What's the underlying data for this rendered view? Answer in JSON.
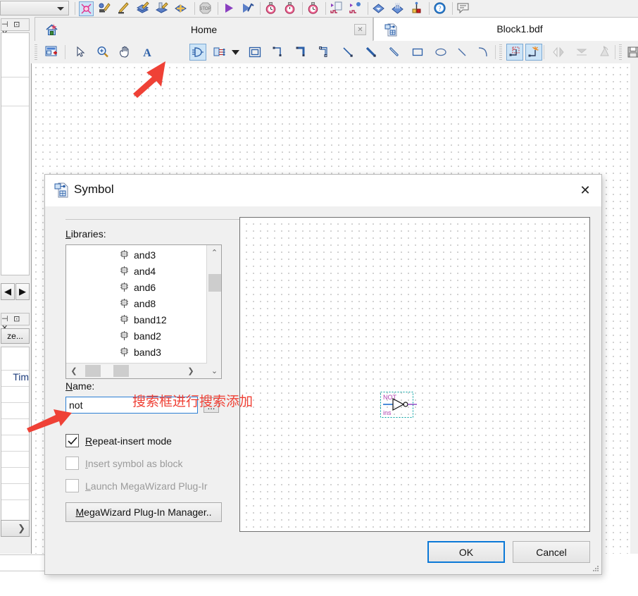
{
  "app": {
    "toolbar_combo_value": "",
    "toolbar_icons": [
      {
        "name": "compile-design-icon",
        "selected": true
      },
      {
        "name": "analysis-synthesis-icon",
        "selected": false
      },
      {
        "name": "fitter-place-route-icon",
        "selected": false
      },
      {
        "name": "assembler-icon",
        "selected": false
      },
      {
        "name": "timing-analyzer-icon",
        "selected": false
      },
      {
        "name": "eda-netlist-writer-icon",
        "selected": false
      },
      {
        "name": "stop-processing-icon",
        "selected": false
      },
      {
        "name": "start-compilation-icon",
        "selected": false
      },
      {
        "name": "start-analysis-icon",
        "selected": false
      },
      {
        "name": "timing-analyzer-tool-icon",
        "selected": false
      },
      {
        "name": "timequest-icon",
        "selected": false
      },
      {
        "name": "timing-report-icon",
        "selected": false
      },
      {
        "name": "program-device-icon",
        "selected": false
      },
      {
        "name": "signaltap-icon",
        "selected": false
      },
      {
        "name": "in-system-memory-editor-icon",
        "selected": false
      },
      {
        "name": "pin-planner-icon",
        "selected": false
      },
      {
        "name": "help-icon",
        "selected": false
      },
      {
        "name": "messages-icon",
        "selected": false
      }
    ]
  },
  "left_dock": {
    "panel1": {
      "title_glyphs": "⊣ ⊡ ✕"
    },
    "panel2": {
      "title_glyphs": "⊣ ⊡ ✕",
      "button_label": "ze..."
    },
    "nav_prev": "◀",
    "nav_next": "▶",
    "table_header": "Tim",
    "bottom_next": "❯",
    "canvas_back": "❮"
  },
  "tabs": [
    {
      "label": "Home",
      "icon": "home-icon",
      "active": false,
      "has_close": true,
      "close_label": "✕"
    },
    {
      "label": "Block1.bdf",
      "icon": "bdf-file-icon",
      "active": true,
      "has_close": false,
      "close_label": ""
    }
  ],
  "draw_toolbar": {
    "tools": [
      {
        "name": "new-block-tool-icon",
        "selected": false,
        "disabled": false
      },
      {
        "name": "selection-tool-icon",
        "selected": false,
        "disabled": false
      },
      {
        "name": "zoom-tool-icon",
        "selected": false,
        "disabled": false
      },
      {
        "name": "hand-tool-icon",
        "selected": false,
        "disabled": false
      },
      {
        "name": "text-tool-icon",
        "selected": false,
        "disabled": false
      },
      {
        "name": "symbol-tool-icon",
        "selected": true,
        "disabled": false
      },
      {
        "name": "pin-tool-icon",
        "selected": false,
        "disabled": false
      },
      {
        "name": "pin-dropdown-caret-icon",
        "selected": false,
        "disabled": false
      },
      {
        "name": "block-tool-icon",
        "selected": false,
        "disabled": false
      },
      {
        "name": "orthogonal-node-tool-icon",
        "selected": false,
        "disabled": false
      },
      {
        "name": "orthogonal-bus-tool-icon",
        "selected": false,
        "disabled": false
      },
      {
        "name": "orthogonal-conduit-tool-icon",
        "selected": false,
        "disabled": false
      },
      {
        "name": "diagonal-node-tool-icon",
        "selected": false,
        "disabled": false
      },
      {
        "name": "diagonal-bus-tool-icon",
        "selected": false,
        "disabled": false
      },
      {
        "name": "diagonal-conduit-tool-icon",
        "selected": false,
        "disabled": false
      },
      {
        "name": "rectangle-tool-icon",
        "selected": false,
        "disabled": false
      },
      {
        "name": "oval-tool-icon",
        "selected": false,
        "disabled": false
      },
      {
        "name": "line-tool-icon",
        "selected": false,
        "disabled": false
      },
      {
        "name": "arc-tool-icon",
        "selected": false,
        "disabled": false
      },
      {
        "name": "rubberbanding-icon",
        "selected": true,
        "disabled": false
      },
      {
        "name": "partial-line-select-icon",
        "selected": true,
        "disabled": false
      },
      {
        "name": "flip-horizontal-icon",
        "selected": false,
        "disabled": true
      },
      {
        "name": "flip-vertical-icon",
        "selected": false,
        "disabled": true
      },
      {
        "name": "rotate-left-icon",
        "selected": false,
        "disabled": true
      },
      {
        "name": "save-icon",
        "selected": false,
        "disabled": false
      },
      {
        "name": "print-icon",
        "selected": false,
        "disabled": false
      }
    ]
  },
  "dialog": {
    "title": "Symbol",
    "title_icon": "symbol-dialog-icon",
    "close_label": "✕",
    "libraries_label": "Libraries:",
    "libraries_accesskey": "L",
    "library_items": [
      {
        "label": "and3",
        "icon": "symbol-item-icon"
      },
      {
        "label": "and4",
        "icon": "symbol-item-icon"
      },
      {
        "label": "and6",
        "icon": "symbol-item-icon"
      },
      {
        "label": "and8",
        "icon": "symbol-item-icon"
      },
      {
        "label": "band12",
        "icon": "symbol-item-icon"
      },
      {
        "label": "band2",
        "icon": "symbol-item-icon"
      },
      {
        "label": "band3",
        "icon": "symbol-item-icon"
      }
    ],
    "scroll_up": "⌃",
    "scroll_down": "⌄",
    "scroll_left": "❮",
    "scroll_right": "❯",
    "name_label": "Name:",
    "name_accesskey": "N",
    "name_value": "not",
    "name_placeholder": "",
    "browse_label": "...",
    "checkboxes": [
      {
        "label": "Repeat-insert mode",
        "accesskey": "R",
        "checked": true,
        "disabled": false,
        "check_glyph": "✓"
      },
      {
        "label": "Insert symbol as block",
        "accesskey": "I",
        "checked": false,
        "disabled": true,
        "check_glyph": ""
      },
      {
        "label": "Launch MegaWizard Plug-Ir",
        "accesskey": "L",
        "checked": false,
        "disabled": true,
        "check_glyph": ""
      }
    ],
    "megawizard_button": "MegaWizard Plug-In Manager..",
    "megawizard_accesskey": "M",
    "ok_label": "OK",
    "cancel_label": "Cancel",
    "preview_symbol": {
      "title": "NOT",
      "instance": "ins",
      "outline_color": "#00a0a0",
      "title_color": "#b040b0",
      "port_color": "#1f6fd0"
    }
  },
  "annotations": {
    "text": "搜索框进行搜索添加",
    "color": "#ef4136",
    "arrows": [
      {
        "name": "arrow-to-symbol-tool"
      },
      {
        "name": "arrow-to-name-input"
      }
    ]
  },
  "colors": {
    "accent_blue": "#0a78d7",
    "selection_blue": "#cce4f7",
    "dialog_bg": "#f0f0f0",
    "annotation_red": "#ef4136"
  }
}
